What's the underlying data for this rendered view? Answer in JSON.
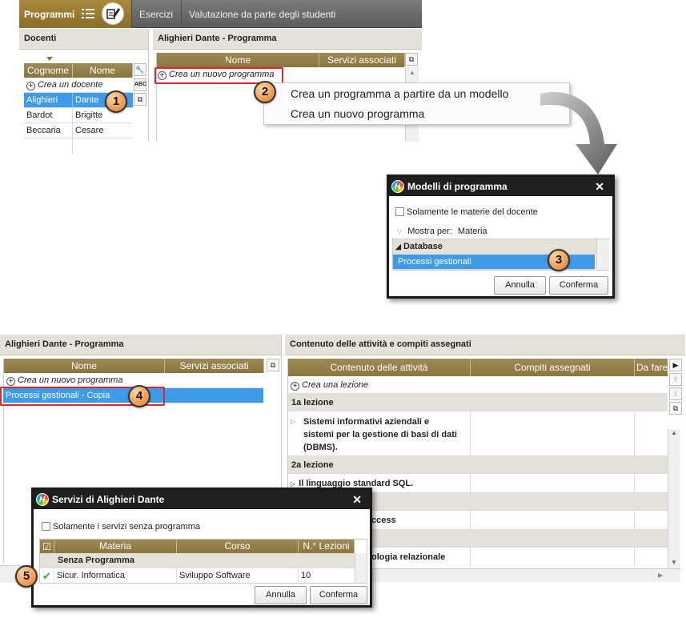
{
  "top": {
    "menubar": {
      "active_tab": "Programmi",
      "items": [
        "Esercizi",
        "Valutazione da parte degli studenti"
      ],
      "icons": [
        "list-icon",
        "edit-icon"
      ]
    },
    "teachers_panel": {
      "title": "Docenti",
      "columns": [
        "Cognome",
        "Nome"
      ],
      "add_label": "Crea un docente",
      "rows": [
        {
          "surname": "Alighieri",
          "name": "Dante",
          "selected": true
        },
        {
          "surname": "Bardot",
          "name": "Brigitte",
          "selected": false
        },
        {
          "surname": "Beccaria",
          "name": "Cesare",
          "selected": false
        }
      ]
    },
    "program_panel": {
      "title": "Alighieri Dante - Programma",
      "columns": [
        "Nome",
        "Servizi associati"
      ],
      "add_label": "Crea un nuovo programma"
    },
    "context_menu": {
      "items": [
        "Crea un programma a partire da un modello",
        "Crea un nuovo programma"
      ]
    }
  },
  "models_dialog": {
    "title": "Modelli di programma",
    "checkbox_label": "Solamente le materie del docente",
    "show_by_label": "Mostra per:",
    "show_by_value": "Materia",
    "group": "Database",
    "item": "Processi gestionali",
    "cancel": "Annulla",
    "confirm": "Conferma"
  },
  "bottom": {
    "program_panel": {
      "title": "Alighieri Dante - Programma",
      "columns": [
        "Nome",
        "Servizi associati"
      ],
      "add_label": "Crea un nuovo programma",
      "selected_row": "Processi gestionali - Copia"
    },
    "content_panel": {
      "title": "Contenuto delle attività e compiti assegnati",
      "columns": [
        "Contenuto delle attività",
        "Compiti assegnati",
        "Da fare"
      ],
      "add_label": "Crea una lezione",
      "lesson1": "1a lezione",
      "activity1": "Sistemi informativi aziendali e sistemi per la gestione de basi di dati (DBMS).",
      "activity1_lines": [
        "Sistemi informativi aziendali e",
        "sistemi per la gestione di basi di dati",
        "(DBMS)."
      ],
      "lesson2": "2a lezione",
      "activity2": "Il linguaggio standard SQL.",
      "activity3_partial": "ccess",
      "activity4_partial": "ologia relazionale"
    }
  },
  "services_dialog": {
    "title": "Servizi di Alighieri Dante",
    "checkbox_label": "Solamente i servizi senza programma",
    "columns": [
      "Materia",
      "Corso",
      "N.° Lezioni"
    ],
    "group": "Senza Programma",
    "row": {
      "subject": "Sicur. Informatica",
      "course": "Sviluppo Software",
      "lessons": "10"
    },
    "cancel": "Annulla",
    "confirm": "Conferma"
  },
  "badges": [
    "1",
    "2",
    "3",
    "4",
    "5"
  ],
  "colors": {
    "accent": "#8a7540",
    "selection": "#3d9be9",
    "highlight_box": "#e0262c",
    "badge": "#f2a25a"
  }
}
